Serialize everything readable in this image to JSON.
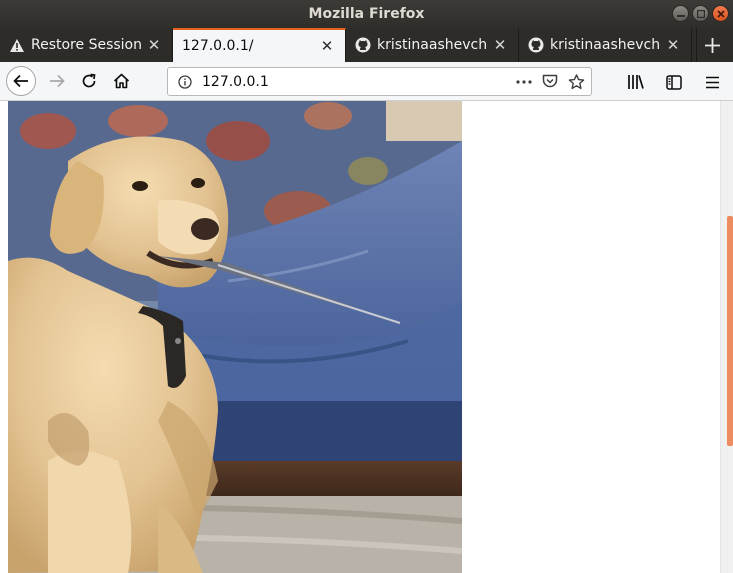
{
  "window": {
    "title": "Mozilla Firefox"
  },
  "tabs": [
    {
      "label": "Restore Session",
      "icon": "warning-icon",
      "selected": false
    },
    {
      "label": "127.0.0.1/",
      "icon": "",
      "selected": true
    },
    {
      "label": "kristinaashevchenko",
      "icon": "github-icon",
      "selected": false
    },
    {
      "label": "kristinaashevchenko",
      "icon": "github-icon",
      "selected": false
    }
  ],
  "navbar": {
    "url": "127.0.0.1",
    "back_enabled": true,
    "forward_enabled": false
  },
  "content": {
    "image_subject": "yellow-labrador-with-knife-on-blue-couch",
    "scroll_position_fraction": 0.24
  },
  "colors": {
    "tab_accent": "#e66020",
    "titlebar": "#3c3b37",
    "scroll_thumb": "#ec8c5f"
  }
}
